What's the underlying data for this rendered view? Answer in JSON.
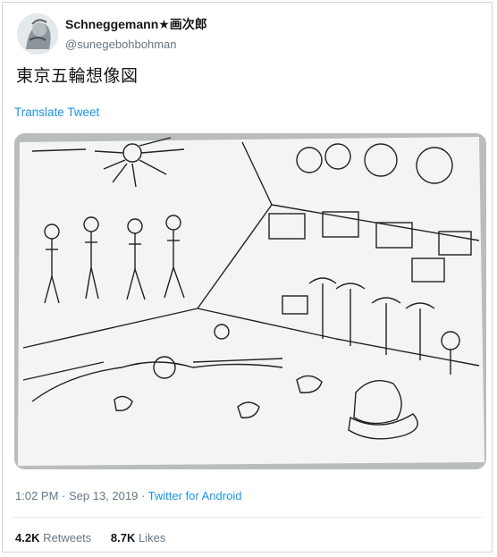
{
  "author": {
    "display_name": "Schneggemann★画次郎",
    "handle": "@sunegebohbohman"
  },
  "tweet": {
    "text": "東京五輪想像図",
    "translate_label": "Translate Tweet"
  },
  "meta": {
    "time": "1:02 PM",
    "sep1": " · ",
    "date": "Sep 13, 2019",
    "sep2": " · ",
    "source": "Twitter for Android"
  },
  "stats": {
    "retweets_count": "4.2K",
    "retweets_label": "Retweets",
    "likes_count": "8.7K",
    "likes_label": "Likes"
  },
  "colors": {
    "link": "#1b95e0",
    "secondary_text": "#657786",
    "primary_text": "#14171a"
  }
}
